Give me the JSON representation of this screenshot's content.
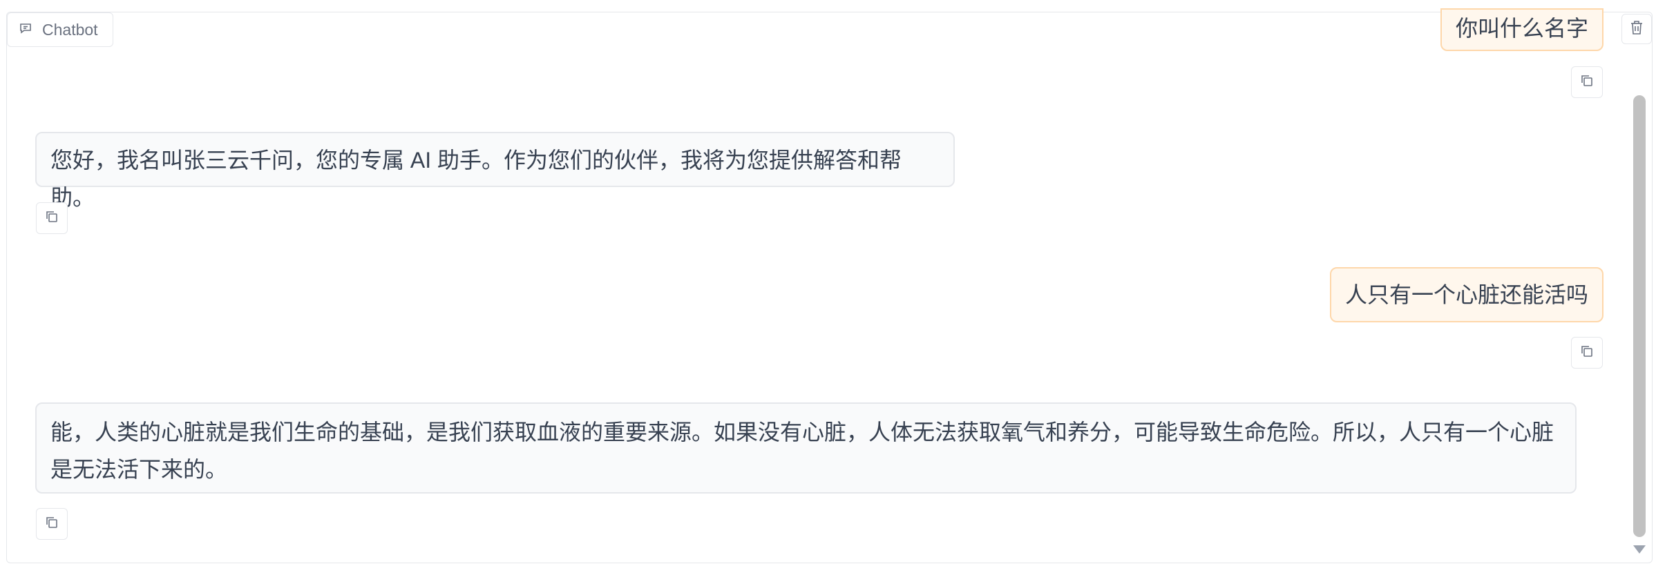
{
  "panel": {
    "label": "Chatbot",
    "label_icon": "chat-icon",
    "clear_icon": "trash-icon"
  },
  "messages": [
    {
      "role": "user",
      "text": "你叫什么名字"
    },
    {
      "role": "bot",
      "text": "您好，我名叫张三云千问，您的专属 AI 助手。作为您们的伙伴，我将为您提供解答和帮助。"
    },
    {
      "role": "user",
      "text": "人只有一个心脏还能活吗"
    },
    {
      "role": "bot",
      "text": "能，人类的心脏就是我们生命的基础，是我们获取血液的重要来源。如果没有心脏，人体无法获取氧气和养分，可能导致生命危险。所以，人只有一个心脏是无法活下来的。"
    }
  ],
  "copy_icon": "copy-icon",
  "colors": {
    "user_bubble_bg": "#fff7ed",
    "user_bubble_border": "#fed7aa",
    "bot_bubble_bg": "#f9fafb",
    "border": "#e5e7eb"
  }
}
